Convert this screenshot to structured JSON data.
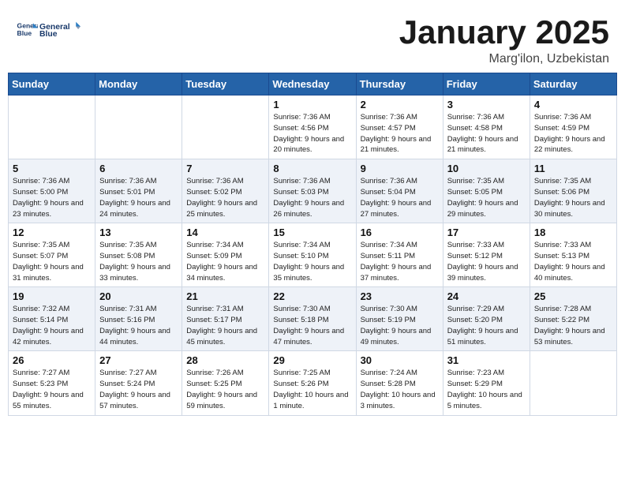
{
  "logo": {
    "line1": "General",
    "line2": "Blue"
  },
  "header": {
    "month": "January 2025",
    "location": "Marg'ilon, Uzbekistan"
  },
  "weekdays": [
    "Sunday",
    "Monday",
    "Tuesday",
    "Wednesday",
    "Thursday",
    "Friday",
    "Saturday"
  ],
  "weeks": [
    [
      {
        "day": "",
        "sunrise": "",
        "sunset": "",
        "daylight": ""
      },
      {
        "day": "",
        "sunrise": "",
        "sunset": "",
        "daylight": ""
      },
      {
        "day": "",
        "sunrise": "",
        "sunset": "",
        "daylight": ""
      },
      {
        "day": "1",
        "sunrise": "Sunrise: 7:36 AM",
        "sunset": "Sunset: 4:56 PM",
        "daylight": "Daylight: 9 hours and 20 minutes."
      },
      {
        "day": "2",
        "sunrise": "Sunrise: 7:36 AM",
        "sunset": "Sunset: 4:57 PM",
        "daylight": "Daylight: 9 hours and 21 minutes."
      },
      {
        "day": "3",
        "sunrise": "Sunrise: 7:36 AM",
        "sunset": "Sunset: 4:58 PM",
        "daylight": "Daylight: 9 hours and 21 minutes."
      },
      {
        "day": "4",
        "sunrise": "Sunrise: 7:36 AM",
        "sunset": "Sunset: 4:59 PM",
        "daylight": "Daylight: 9 hours and 22 minutes."
      }
    ],
    [
      {
        "day": "5",
        "sunrise": "Sunrise: 7:36 AM",
        "sunset": "Sunset: 5:00 PM",
        "daylight": "Daylight: 9 hours and 23 minutes."
      },
      {
        "day": "6",
        "sunrise": "Sunrise: 7:36 AM",
        "sunset": "Sunset: 5:01 PM",
        "daylight": "Daylight: 9 hours and 24 minutes."
      },
      {
        "day": "7",
        "sunrise": "Sunrise: 7:36 AM",
        "sunset": "Sunset: 5:02 PM",
        "daylight": "Daylight: 9 hours and 25 minutes."
      },
      {
        "day": "8",
        "sunrise": "Sunrise: 7:36 AM",
        "sunset": "Sunset: 5:03 PM",
        "daylight": "Daylight: 9 hours and 26 minutes."
      },
      {
        "day": "9",
        "sunrise": "Sunrise: 7:36 AM",
        "sunset": "Sunset: 5:04 PM",
        "daylight": "Daylight: 9 hours and 27 minutes."
      },
      {
        "day": "10",
        "sunrise": "Sunrise: 7:35 AM",
        "sunset": "Sunset: 5:05 PM",
        "daylight": "Daylight: 9 hours and 29 minutes."
      },
      {
        "day": "11",
        "sunrise": "Sunrise: 7:35 AM",
        "sunset": "Sunset: 5:06 PM",
        "daylight": "Daylight: 9 hours and 30 minutes."
      }
    ],
    [
      {
        "day": "12",
        "sunrise": "Sunrise: 7:35 AM",
        "sunset": "Sunset: 5:07 PM",
        "daylight": "Daylight: 9 hours and 31 minutes."
      },
      {
        "day": "13",
        "sunrise": "Sunrise: 7:35 AM",
        "sunset": "Sunset: 5:08 PM",
        "daylight": "Daylight: 9 hours and 33 minutes."
      },
      {
        "day": "14",
        "sunrise": "Sunrise: 7:34 AM",
        "sunset": "Sunset: 5:09 PM",
        "daylight": "Daylight: 9 hours and 34 minutes."
      },
      {
        "day": "15",
        "sunrise": "Sunrise: 7:34 AM",
        "sunset": "Sunset: 5:10 PM",
        "daylight": "Daylight: 9 hours and 35 minutes."
      },
      {
        "day": "16",
        "sunrise": "Sunrise: 7:34 AM",
        "sunset": "Sunset: 5:11 PM",
        "daylight": "Daylight: 9 hours and 37 minutes."
      },
      {
        "day": "17",
        "sunrise": "Sunrise: 7:33 AM",
        "sunset": "Sunset: 5:12 PM",
        "daylight": "Daylight: 9 hours and 39 minutes."
      },
      {
        "day": "18",
        "sunrise": "Sunrise: 7:33 AM",
        "sunset": "Sunset: 5:13 PM",
        "daylight": "Daylight: 9 hours and 40 minutes."
      }
    ],
    [
      {
        "day": "19",
        "sunrise": "Sunrise: 7:32 AM",
        "sunset": "Sunset: 5:14 PM",
        "daylight": "Daylight: 9 hours and 42 minutes."
      },
      {
        "day": "20",
        "sunrise": "Sunrise: 7:31 AM",
        "sunset": "Sunset: 5:16 PM",
        "daylight": "Daylight: 9 hours and 44 minutes."
      },
      {
        "day": "21",
        "sunrise": "Sunrise: 7:31 AM",
        "sunset": "Sunset: 5:17 PM",
        "daylight": "Daylight: 9 hours and 45 minutes."
      },
      {
        "day": "22",
        "sunrise": "Sunrise: 7:30 AM",
        "sunset": "Sunset: 5:18 PM",
        "daylight": "Daylight: 9 hours and 47 minutes."
      },
      {
        "day": "23",
        "sunrise": "Sunrise: 7:30 AM",
        "sunset": "Sunset: 5:19 PM",
        "daylight": "Daylight: 9 hours and 49 minutes."
      },
      {
        "day": "24",
        "sunrise": "Sunrise: 7:29 AM",
        "sunset": "Sunset: 5:20 PM",
        "daylight": "Daylight: 9 hours and 51 minutes."
      },
      {
        "day": "25",
        "sunrise": "Sunrise: 7:28 AM",
        "sunset": "Sunset: 5:22 PM",
        "daylight": "Daylight: 9 hours and 53 minutes."
      }
    ],
    [
      {
        "day": "26",
        "sunrise": "Sunrise: 7:27 AM",
        "sunset": "Sunset: 5:23 PM",
        "daylight": "Daylight: 9 hours and 55 minutes."
      },
      {
        "day": "27",
        "sunrise": "Sunrise: 7:27 AM",
        "sunset": "Sunset: 5:24 PM",
        "daylight": "Daylight: 9 hours and 57 minutes."
      },
      {
        "day": "28",
        "sunrise": "Sunrise: 7:26 AM",
        "sunset": "Sunset: 5:25 PM",
        "daylight": "Daylight: 9 hours and 59 minutes."
      },
      {
        "day": "29",
        "sunrise": "Sunrise: 7:25 AM",
        "sunset": "Sunset: 5:26 PM",
        "daylight": "Daylight: 10 hours and 1 minute."
      },
      {
        "day": "30",
        "sunrise": "Sunrise: 7:24 AM",
        "sunset": "Sunset: 5:28 PM",
        "daylight": "Daylight: 10 hours and 3 minutes."
      },
      {
        "day": "31",
        "sunrise": "Sunrise: 7:23 AM",
        "sunset": "Sunset: 5:29 PM",
        "daylight": "Daylight: 10 hours and 5 minutes."
      },
      {
        "day": "",
        "sunrise": "",
        "sunset": "",
        "daylight": ""
      }
    ]
  ]
}
